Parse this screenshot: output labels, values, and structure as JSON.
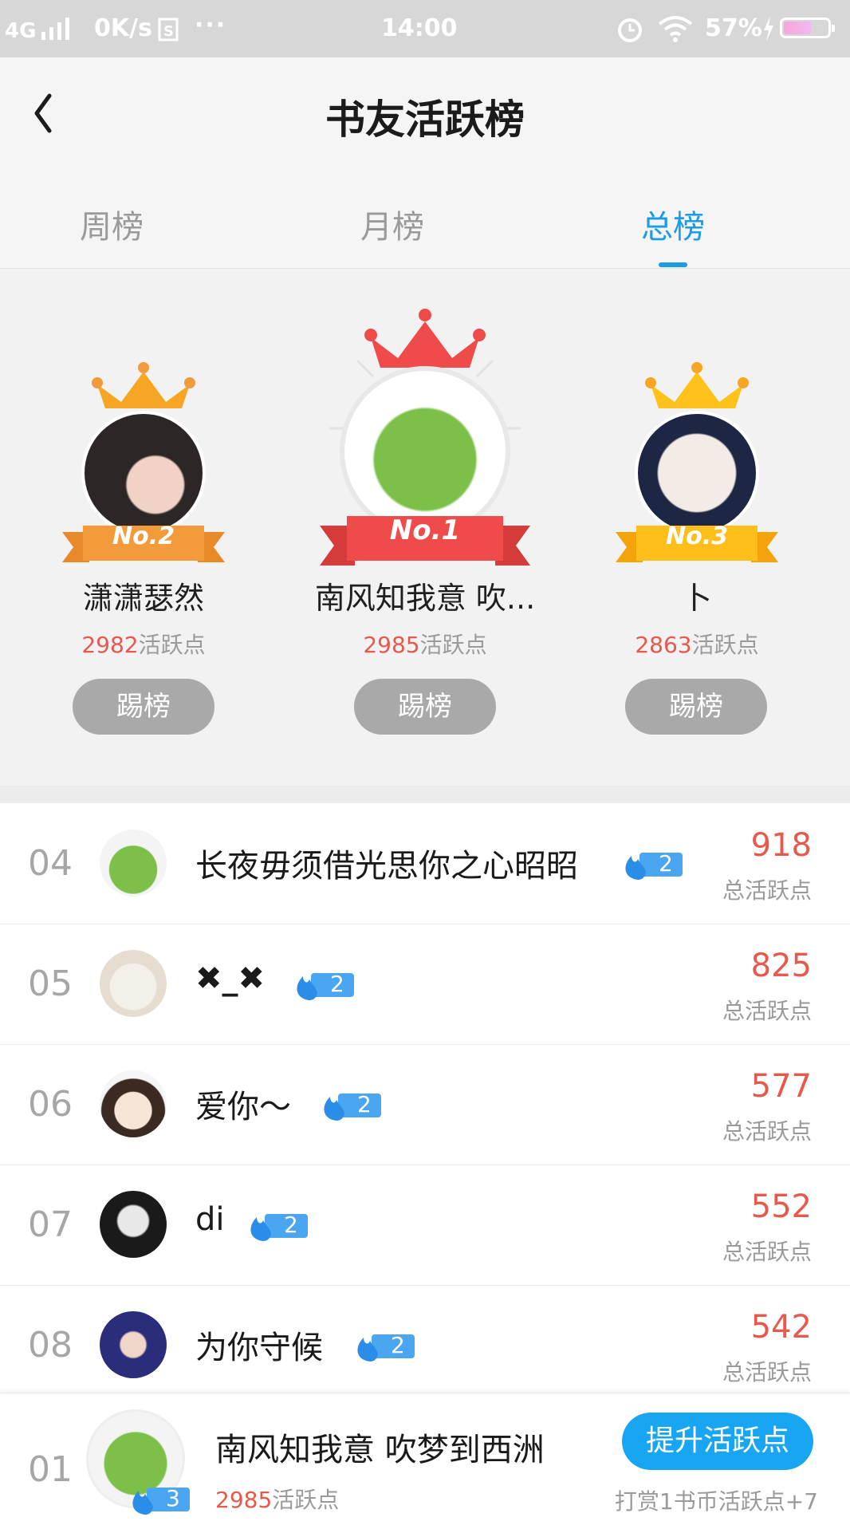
{
  "status_bar": {
    "network": "4G",
    "speed": "0K/s",
    "time": "14:00",
    "battery": "57%",
    "icons": [
      "signal-icon",
      "sim-icon",
      "more-dots-icon",
      "alarm-icon",
      "wifi-icon",
      "charging-icon",
      "battery-icon"
    ]
  },
  "header": {
    "title": "书友活跃榜",
    "back_icon": "chevron-left-icon"
  },
  "tabs": [
    {
      "label": "周榜",
      "active": false
    },
    {
      "label": "月榜",
      "active": false
    },
    {
      "label": "总榜",
      "active": true
    }
  ],
  "podium": [
    {
      "rank_label": "No.2",
      "name": "潇潇瑟然",
      "points": "2982",
      "points_suffix": "活跃点",
      "kick_label": "踢榜"
    },
    {
      "rank_label": "No.1",
      "name": "南风知我意  吹...",
      "points": "2985",
      "points_suffix": "活跃点",
      "kick_label": "踢榜"
    },
    {
      "rank_label": "No.3",
      "name": "卜",
      "points": "2863",
      "points_suffix": "活跃点",
      "kick_label": "踢榜"
    }
  ],
  "list": [
    {
      "rank": "04",
      "name": "长夜毋须借光思你之心昭昭",
      "level": "2",
      "score": "918",
      "score_label": "总活跃点"
    },
    {
      "rank": "05",
      "name": "✖_✖",
      "level": "2",
      "score": "825",
      "score_label": "总活跃点"
    },
    {
      "rank": "06",
      "name": "爱你～",
      "level": "2",
      "score": "577",
      "score_label": "总活跃点"
    },
    {
      "rank": "07",
      "name": "di",
      "level": "2",
      "score": "552",
      "score_label": "总活跃点"
    },
    {
      "rank": "08",
      "name": "为你守候",
      "level": "2",
      "score": "542",
      "score_label": "总活跃点"
    }
  ],
  "footer": {
    "rank": "01",
    "name": "南风知我意  吹梦到西洲",
    "level": "3",
    "points": "2985",
    "points_suffix": "活跃点",
    "button_label": "提升活跃点",
    "note": "打赏1书币活跃点+7"
  },
  "colors": {
    "accent": "#1c9be6",
    "score": "#e6594c",
    "gold": "#f6a623",
    "red": "#ef4b4b",
    "orange": "#f39a3a"
  }
}
